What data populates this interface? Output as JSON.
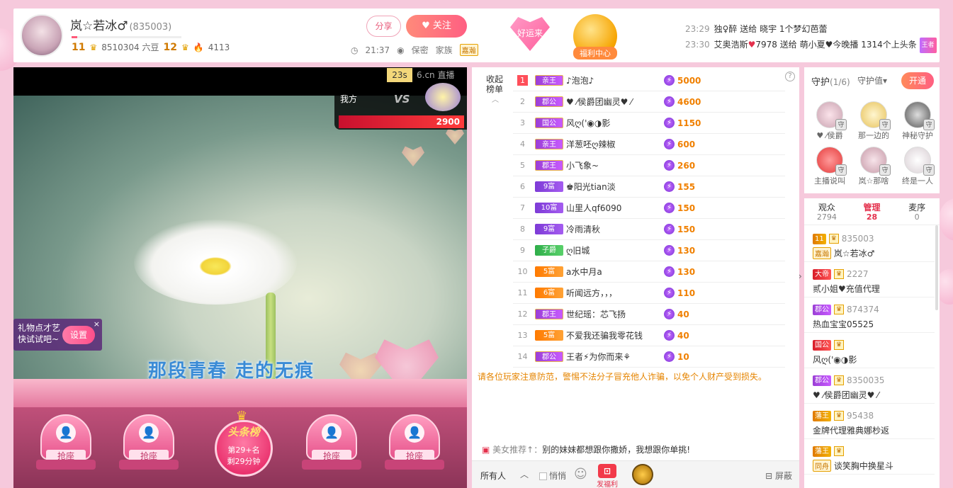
{
  "header": {
    "anchor_name": "岚☆若冰♂",
    "room_id": "(835003)",
    "level": "11",
    "beans": "8510304 六豆",
    "wealth_level": "12",
    "popularity": "4113",
    "share_label": "分享",
    "follow_label": "关注",
    "time": "21:37",
    "location": "保密",
    "family_label": "家族",
    "family_tag": "嘉瀚",
    "luck_label": "好运来",
    "welfare_label": "福利中心"
  },
  "gift_feed": [
    {
      "time": "23:29",
      "sender": "独♀醉",
      "action": "送给",
      "receiver": "晓宇",
      "gift": "1个梦幻芭蕾"
    },
    {
      "time": "23:30",
      "sender": "艾奥浩斯",
      "num": "7978",
      "action": "送给",
      "receiver": "萌小夏♥今晚播",
      "gift": "1314个上头条",
      "tag": "王者"
    }
  ],
  "video": {
    "pk_timer": "23s",
    "pk_logo": "6.cn 直播",
    "pk_us": "我方",
    "pk_vs": "VS",
    "pk_score": "2900",
    "lyric": "那段青春  走的无痕",
    "gift_tip_line1": "礼物点才艺",
    "gift_tip_line2": "快试试吧~",
    "gift_tip_set": "设置",
    "gift_tip_close": "×",
    "seat_label": "抢座",
    "headline_title": "头条榜",
    "headline_rank": "第29+名",
    "headline_left": "剩29分钟"
  },
  "rank": {
    "toggle": "收起榜单",
    "help": "?",
    "rows": [
      {
        "no": "1",
        "tag": "亲王",
        "tag_style": "purple",
        "name": "♪泡泡♪",
        "value": "5000"
      },
      {
        "no": "2",
        "tag": "郡公",
        "tag_style": "purple",
        "name": "♥ ⁄侯爵团幽灵♥ ⁄",
        "value": "4600"
      },
      {
        "no": "3",
        "tag": "国公",
        "tag_style": "purple",
        "name": "风ღ('◉◑影",
        "value": "1150"
      },
      {
        "no": "4",
        "tag": "亲王",
        "tag_style": "purple",
        "name": "洋葱呸ღ辣椒",
        "value": "600"
      },
      {
        "no": "5",
        "tag": "郡王",
        "tag_style": "purple",
        "name": "小飞象~",
        "value": "260"
      },
      {
        "no": "6",
        "tag": "9富",
        "tag_style": "violet",
        "name": "♚阳光tian淡",
        "value": "155"
      },
      {
        "no": "7",
        "tag": "10富",
        "tag_style": "violet",
        "name": "山里人qf6090",
        "value": "150"
      },
      {
        "no": "8",
        "tag": "9富",
        "tag_style": "violet",
        "name": "冷雨清秋",
        "value": "150"
      },
      {
        "no": "9",
        "tag": "子爵",
        "tag_style": "green",
        "name": "ღ旧城",
        "value": "130"
      },
      {
        "no": "10",
        "tag": "5富",
        "tag_style": "orange",
        "name": "a水中月a",
        "value": "130"
      },
      {
        "no": "11",
        "tag": "6富",
        "tag_style": "orange",
        "name": "听闻远方，，，",
        "value": "110"
      },
      {
        "no": "12",
        "tag": "郡王",
        "tag_style": "purple",
        "name": "世纪瑶：芯飞扬",
        "value": "40"
      },
      {
        "no": "13",
        "tag": "5富",
        "tag_style": "orange",
        "name": "不爱我还骗我零花钱",
        "value": "40"
      },
      {
        "no": "14",
        "tag": "郡公",
        "tag_style": "purple",
        "name": "王者⚡为你而来⚘",
        "value": "10"
      }
    ]
  },
  "chat": {
    "top_notice": "请各位玩家注意防范，警惕不法分子冒充他人诈骗，以免个人财产受到损失。",
    "recommend_src": "美女推荐↑：",
    "recommend_text": "别的妹妹都想跟你撒娇，我想跟你单挑!",
    "target": "所有人",
    "quiet": "悄悄",
    "welfare": "发福利",
    "screen": "屏蔽"
  },
  "guard": {
    "title": "守护",
    "count": "(1/6)",
    "value_label": "守护值",
    "open_label": "开通",
    "items": [
      {
        "name": "♥ ⁄侯爵",
        "shield": "守"
      },
      {
        "name": "那一边的",
        "shield": "守"
      },
      {
        "name": "神秘守护",
        "shield": "守"
      },
      {
        "name": "主播说叫",
        "shield": "守"
      },
      {
        "name": "岚☆那啥",
        "shield": "守"
      },
      {
        "name": "终是一人",
        "shield": "守"
      }
    ]
  },
  "users": {
    "tabs": [
      {
        "label": "观众",
        "num": "2794"
      },
      {
        "label": "管理",
        "num": "28"
      },
      {
        "label": "麦序",
        "num": "0"
      }
    ],
    "rows": [
      {
        "badge": "11",
        "badge_style": "gold",
        "id": "835003",
        "sub_badge": "嘉瀚",
        "name": "岚☆若冰♂"
      },
      {
        "badge": "大帝",
        "badge_style": "red",
        "id": "2227",
        "name": "贰小姐♥充值代理"
      },
      {
        "badge": "郡公",
        "badge_style": "purple",
        "id": "874374",
        "name": "热血宝宝05525"
      },
      {
        "badge": "国公",
        "badge_style": "red",
        "id": "",
        "name": "风ღ('◉◑影"
      },
      {
        "badge": "郡公",
        "badge_style": "purple",
        "id": "8350035",
        "name": "♥ ⁄侯爵团幽灵♥ ⁄"
      },
      {
        "badge": "藩王",
        "badge_style": "gold",
        "id": "95438",
        "name": "金牌代理雅典娜杪返"
      },
      {
        "badge": "藩王",
        "badge_style": "gold",
        "id": "",
        "sub_badge": "同舟",
        "name": "谈笑胸中换星斗"
      }
    ]
  }
}
